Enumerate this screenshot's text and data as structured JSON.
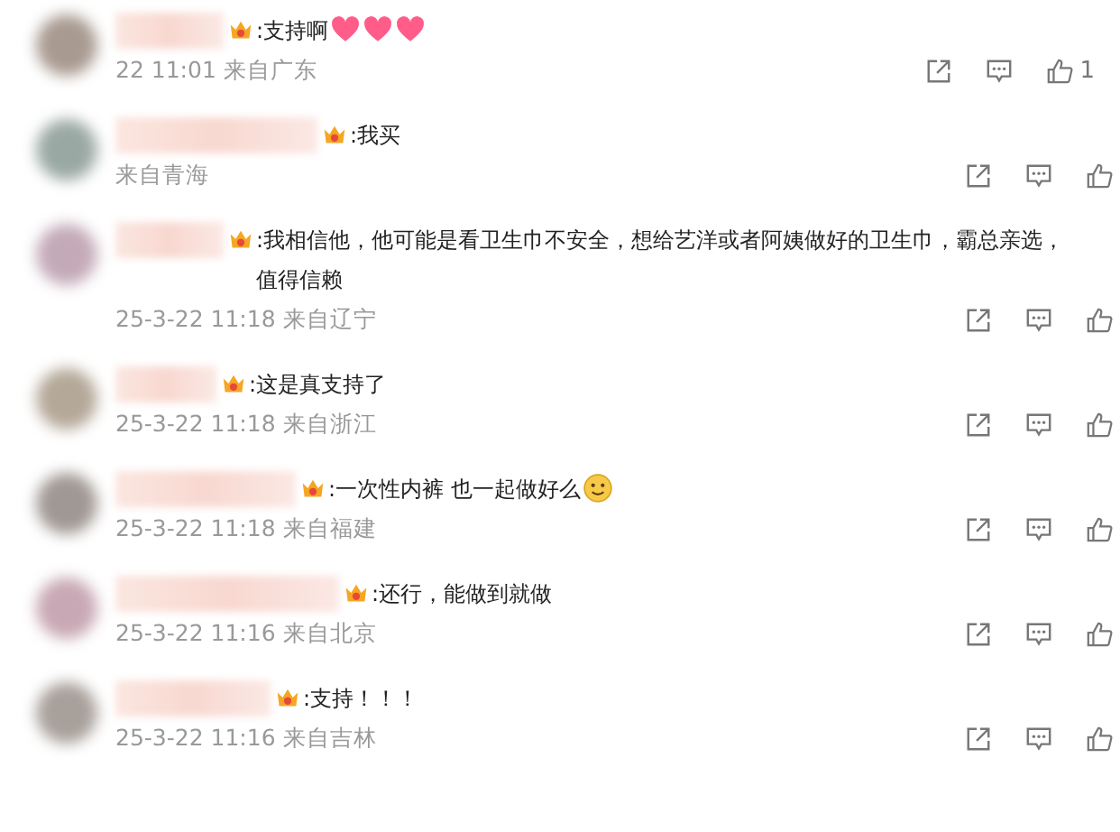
{
  "comments": [
    {
      "text": ":支持啊",
      "emojis": [
        {
          "kind": "heart"
        },
        {
          "kind": "heart"
        },
        {
          "kind": "heart"
        }
      ],
      "meta": "22 11:01 来自广东",
      "likes": "1"
    },
    {
      "text": ":我买",
      "meta": "来自青海"
    },
    {
      "text": ":我相信他，他可能是看卫生巾不安全，想给艺洋或者阿姨做好的卫生巾，霸总亲选，值得信赖",
      "meta": "25-3-22 11:18 来自辽宁"
    },
    {
      "text": ":这是真支持了",
      "meta": "25-3-22 11:18 来自浙江"
    },
    {
      "text": ":一次性内裤 也一起做好么",
      "emojis": [
        {
          "kind": "smile"
        }
      ],
      "meta": "25-3-22 11:18 来自福建"
    },
    {
      "text": ":还行，能做到就做",
      "meta": "25-3-22 11:16 来自北京"
    },
    {
      "text": ":支持！！！",
      "meta": "25-3-22 11:16 来自吉林"
    }
  ]
}
